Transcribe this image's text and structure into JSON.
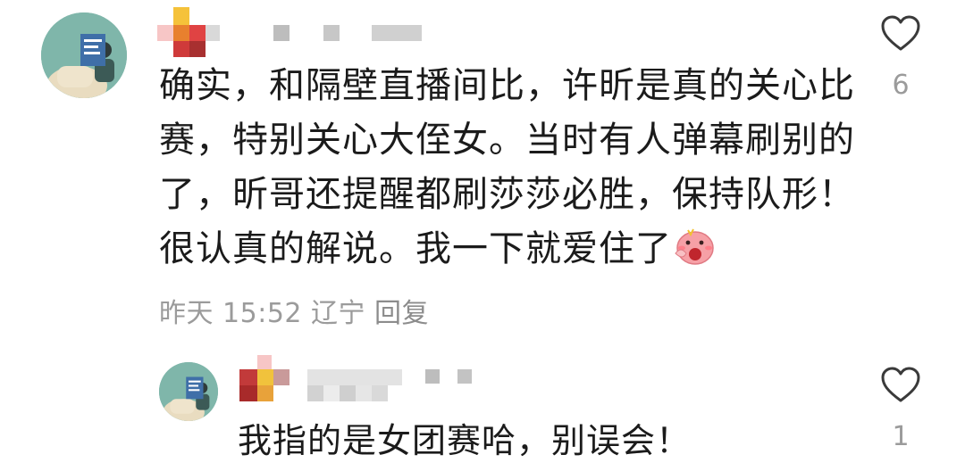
{
  "comments": [
    {
      "text": "确实，和隔壁直播间比，许昕是真的关心比赛，特别关心大侄女。当时有人弹幕刷别的了，昕哥还提醒都刷莎莎必胜，保持队形！很认真的解说。我一下就爱住了",
      "lines": [
        "确实，和隔壁直播间比，许昕是真的关心比",
        "赛，特别关心大侄女。当时有人弹幕刷别的",
        "了，昕哥还提醒都刷莎莎必胜，保持队形！",
        "很认真的解说。我一下就爱住了"
      ],
      "emoji": "pig-face-emoji",
      "time": "昨天 15:52",
      "location": "辽宁",
      "reply_label": "回复",
      "like_count": "6"
    },
    {
      "text": "我指的是女团赛哈，别误会！",
      "like_count": "1"
    }
  ],
  "icons": {
    "like": "heart-outline-icon"
  },
  "colors": {
    "meta_text": "#9b9b9b",
    "body_text": "#1b1b1b",
    "heart_stroke": "#3a3a3a",
    "avatar_bg": "#7fb6aa"
  }
}
